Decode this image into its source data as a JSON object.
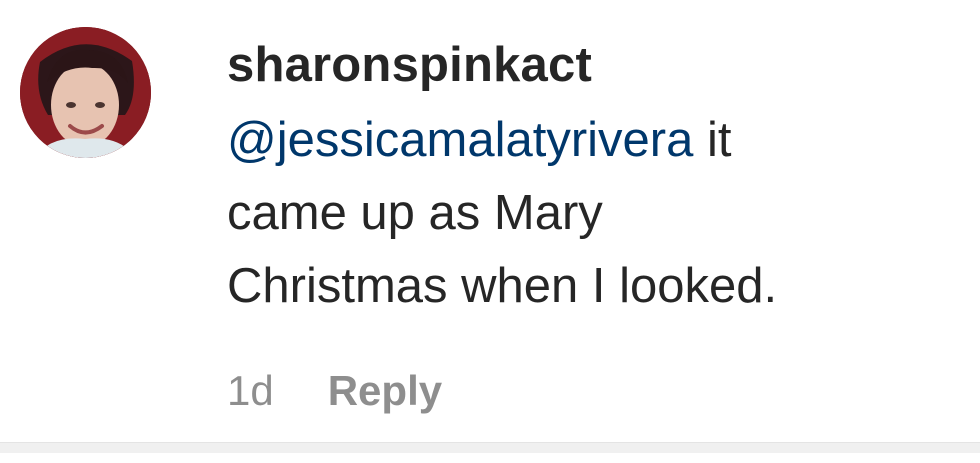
{
  "comment": {
    "username": "sharonspinkact",
    "mention": "@jessicamalatyrivera",
    "text_line1_rest": " it",
    "text_line2": "came up as Mary",
    "text_line3": "Christmas when I looked.",
    "timestamp": "1d",
    "reply_label": "Reply",
    "avatar": "profile-photo"
  },
  "colors": {
    "text": "#262626",
    "mention": "#00376b",
    "meta": "#8e8e8e"
  }
}
